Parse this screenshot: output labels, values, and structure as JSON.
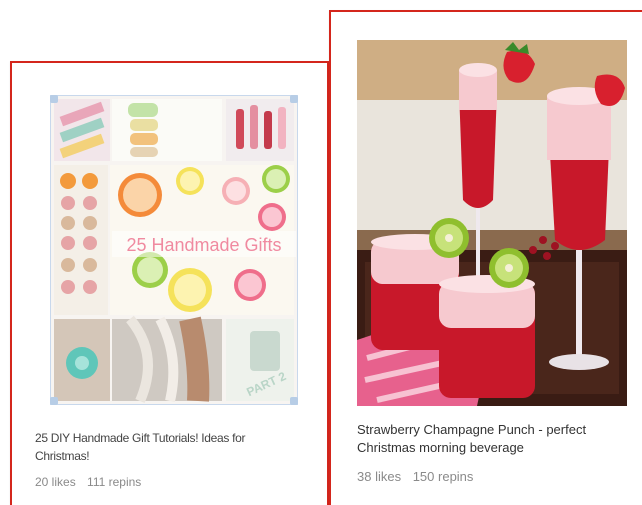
{
  "pins": [
    {
      "id": "pin-handmade-gifts",
      "image_overlay_text": "25 Handmade Gifts",
      "image_corner_text": "PART 2",
      "description": "25 DIY Handmade Gift Tutorials! Ideas for Christmas!",
      "likes": "20 likes",
      "repins": "111 repins"
    },
    {
      "id": "pin-strawberry-punch",
      "description": "Strawberry Champagne Punch - perfect Christmas morning beverage",
      "likes": "38 likes",
      "repins": "150 repins"
    }
  ],
  "colors": {
    "pin_border": "#d4261c",
    "caption_text": "#333333",
    "stats_text": "#8a8a8a",
    "punch_red": "#c8182a",
    "foam_pink": "#f6c9cf",
    "kiwi_green": "#8fbf2e"
  }
}
